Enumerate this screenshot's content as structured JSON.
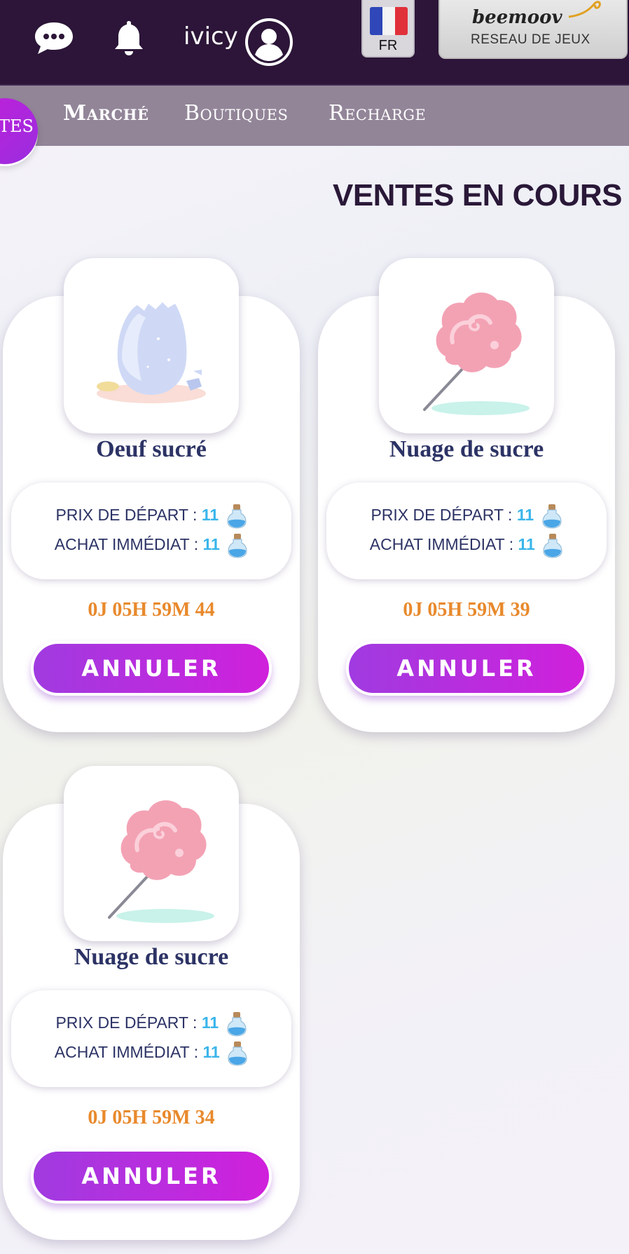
{
  "header": {
    "username": "ivicy",
    "language_code": "FR",
    "logo_brand": "beemoov",
    "logo_tagline": "RESEAU DE JEUX"
  },
  "nav": {
    "active_partial": "TES",
    "items": [
      {
        "label": "Marché"
      },
      {
        "label": "Boutiques"
      },
      {
        "label": "Recharge"
      }
    ]
  },
  "page": {
    "title": "VENTES EN COURS"
  },
  "sales": [
    {
      "name": "Oeuf sucré",
      "icon": "sugar-egg-icon",
      "starting_price_label": "PRIX DE DÉPART : ",
      "starting_price": "11",
      "buyout_label": "ACHAT IMMÉDIAT : ",
      "buyout_price": "11",
      "timer": "0J 05H 59M 44",
      "cancel_label": "ANNULER"
    },
    {
      "name": "Nuage de sucre",
      "icon": "cotton-candy-icon",
      "starting_price_label": "PRIX DE DÉPART : ",
      "starting_price": "11",
      "buyout_label": "ACHAT IMMÉDIAT : ",
      "buyout_price": "11",
      "timer": "0J 05H 59M 39",
      "cancel_label": "ANNULER"
    },
    {
      "name": "Nuage de sucre",
      "icon": "cotton-candy-icon",
      "starting_price_label": "PRIX DE DÉPART : ",
      "starting_price": "11",
      "buyout_label": "ACHAT IMMÉDIAT : ",
      "buyout_price": "11",
      "timer": "0J 05H 59M 34",
      "cancel_label": "ANNULER"
    }
  ],
  "colors": {
    "topbar": "#2c1538",
    "navbar": "#928598",
    "accent_purple": "#b52fe0",
    "price_value": "#3ab5ea",
    "timer": "#e8892c",
    "item_name": "#2c3365"
  }
}
